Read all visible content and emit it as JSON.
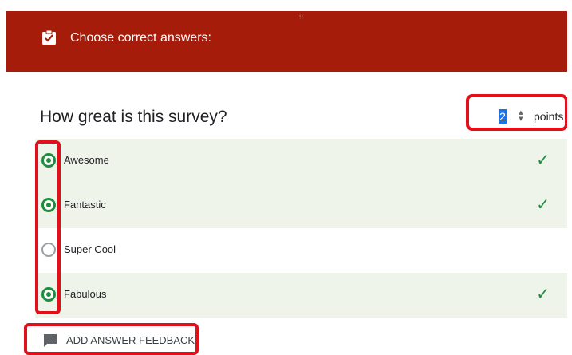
{
  "header": {
    "title": "Choose correct answers:",
    "icon": "assignment-check-icon",
    "color": "#a51c0b"
  },
  "question": {
    "title": "How great is this survey?",
    "points_value": "2",
    "points_label": "points"
  },
  "options": [
    {
      "label": "Awesome",
      "selected": true,
      "correct": true
    },
    {
      "label": "Fantastic",
      "selected": true,
      "correct": true
    },
    {
      "label": "Super Cool",
      "selected": false,
      "correct": false
    },
    {
      "label": "Fabulous",
      "selected": true,
      "correct": true
    }
  ],
  "feedback": {
    "label": "ADD ANSWER FEEDBACK",
    "icon": "comment-icon"
  },
  "colors": {
    "highlight": "#e3101c",
    "correct_green": "#1e8e3e",
    "correct_row_bg": "#eef4e9"
  }
}
